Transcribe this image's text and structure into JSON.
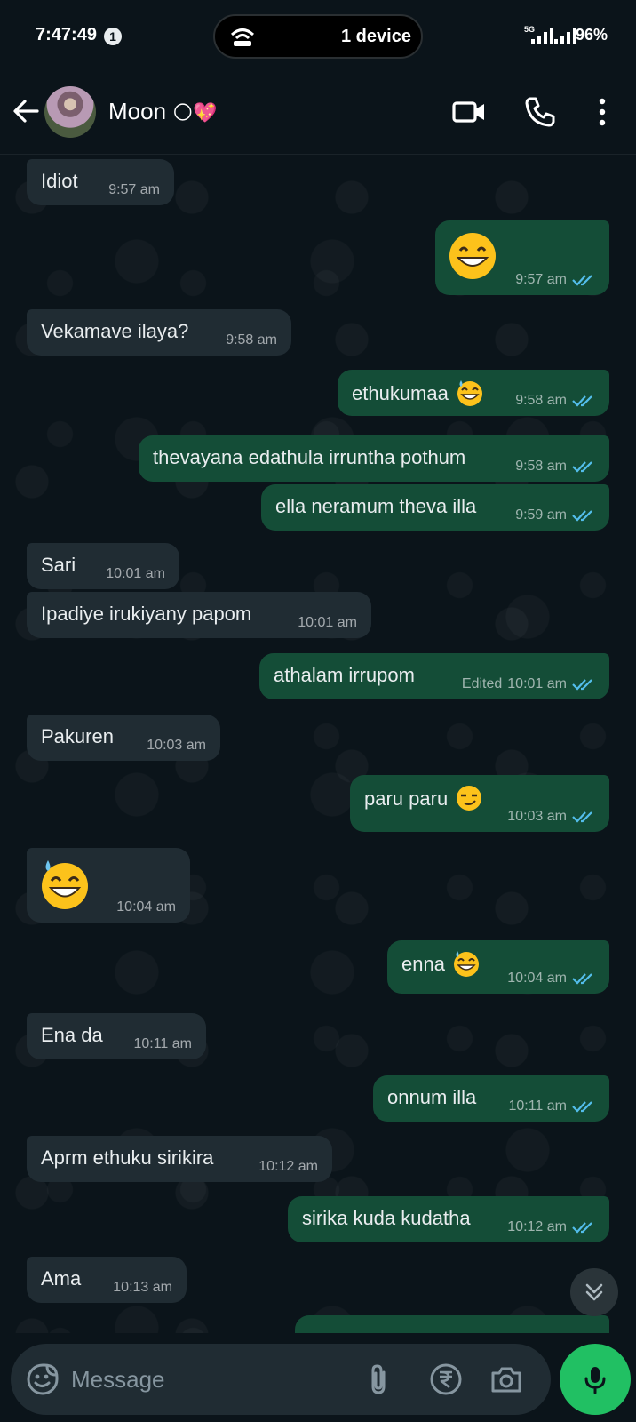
{
  "status_bar": {
    "time": "7:47:49",
    "info_badge": "1",
    "pill_text": "1 device",
    "network_label": "5G",
    "battery": "96%"
  },
  "header": {
    "contact_name": "Moon",
    "name_emojis": "🌕💖"
  },
  "messages": [
    {
      "dir": "in",
      "text": "Idiot",
      "time": "9:57 am"
    },
    {
      "dir": "out",
      "emoji": "grin",
      "time": "9:57 am",
      "read": true
    },
    {
      "dir": "in",
      "text": "Vekamave ilaya?",
      "time": "9:58 am"
    },
    {
      "dir": "out",
      "text": "ethukumaa",
      "emoji": "sweat-smile",
      "time": "9:58 am",
      "read": true
    },
    {
      "dir": "out",
      "text": "thevayana edathula irruntha pothum",
      "time": "9:58 am",
      "read": true
    },
    {
      "dir": "out",
      "text": "ella neramum theva illa",
      "time": "9:59 am",
      "read": true
    },
    {
      "dir": "in",
      "text": "Sari",
      "time": "10:01 am"
    },
    {
      "dir": "in",
      "text": "Ipadiye irukiyany papom",
      "time": "10:01 am"
    },
    {
      "dir": "out",
      "text": "athalam irrupom",
      "edited_label": "Edited",
      "time": "10:01 am",
      "read": true
    },
    {
      "dir": "in",
      "text": "Pakuren",
      "time": "10:03 am"
    },
    {
      "dir": "out",
      "text": "paru paru",
      "emoji": "smirk",
      "time": "10:03 am",
      "read": true
    },
    {
      "dir": "in",
      "emoji": "sweat-smile",
      "time": "10:04 am"
    },
    {
      "dir": "out",
      "text": "enna",
      "emoji": "sweat-smile",
      "time": "10:04 am",
      "read": true
    },
    {
      "dir": "in",
      "text": "Ena da",
      "time": "10:11 am"
    },
    {
      "dir": "out",
      "text": "onnum illa",
      "time": "10:11 am",
      "read": true
    },
    {
      "dir": "in",
      "text": "Aprm ethuku sirikira",
      "time": "10:12 am"
    },
    {
      "dir": "out",
      "text": "sirika kuda kudatha",
      "time": "10:12 am",
      "read": true
    },
    {
      "dir": "in",
      "text": "Ama",
      "time": "10:13 am"
    }
  ],
  "composer": {
    "placeholder": "Message"
  },
  "colors": {
    "background": "#0b141a",
    "incoming_bubble": "#202c33",
    "outgoing_bubble": "#144d37",
    "read_ticks": "#53bdeb",
    "mic_button": "#21c063"
  }
}
